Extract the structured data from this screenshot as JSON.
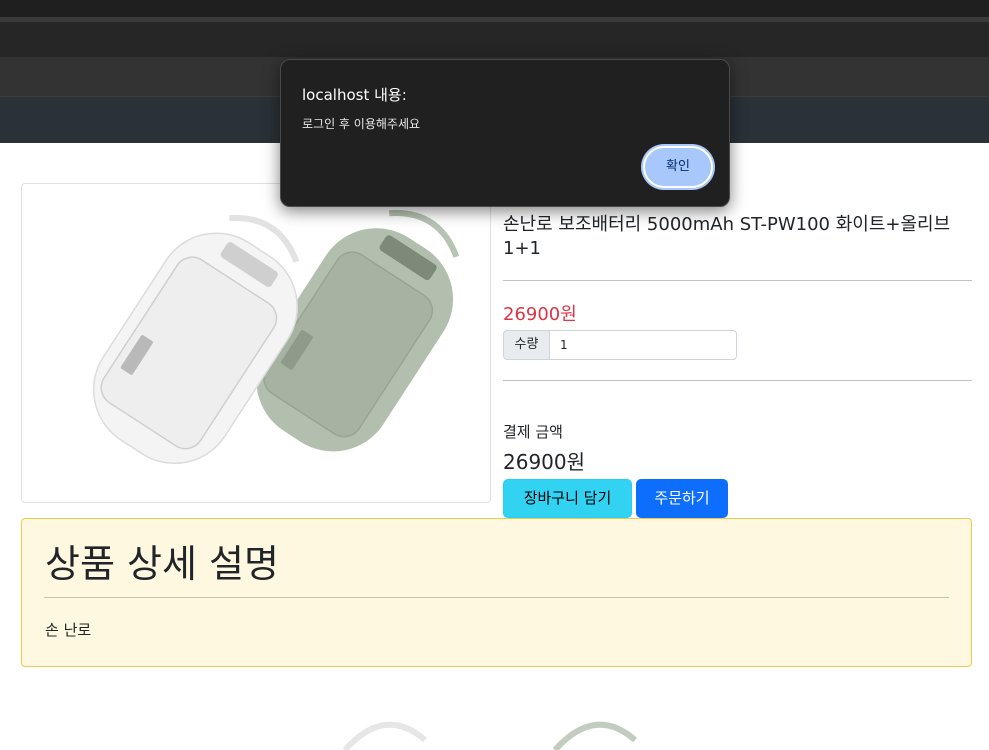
{
  "dialog": {
    "title": "localhost 내용:",
    "message": "로그인 후 이용해주세요",
    "ok_label": "확인"
  },
  "product": {
    "title": "손난로 보조배터리 5000mAh ST-PW100 화이트+올리브 1+1",
    "price": "26900원",
    "quantity_label": "수량",
    "quantity_value": "1",
    "total_label": "결제 금액",
    "total_value": "26900원",
    "cart_button": "장바구니 담기",
    "order_button": "주문하기"
  },
  "detail": {
    "title": "상품 상세 설명",
    "text": "손 난로"
  },
  "colors": {
    "price": "#dc3545",
    "cart_button": "#31d2f2",
    "order_button": "#0d6efd",
    "detail_bg": "#fff8e1",
    "detail_border": "#f2c94c",
    "dialog_bg": "#202020",
    "dialog_button": "#a8c7fa"
  }
}
